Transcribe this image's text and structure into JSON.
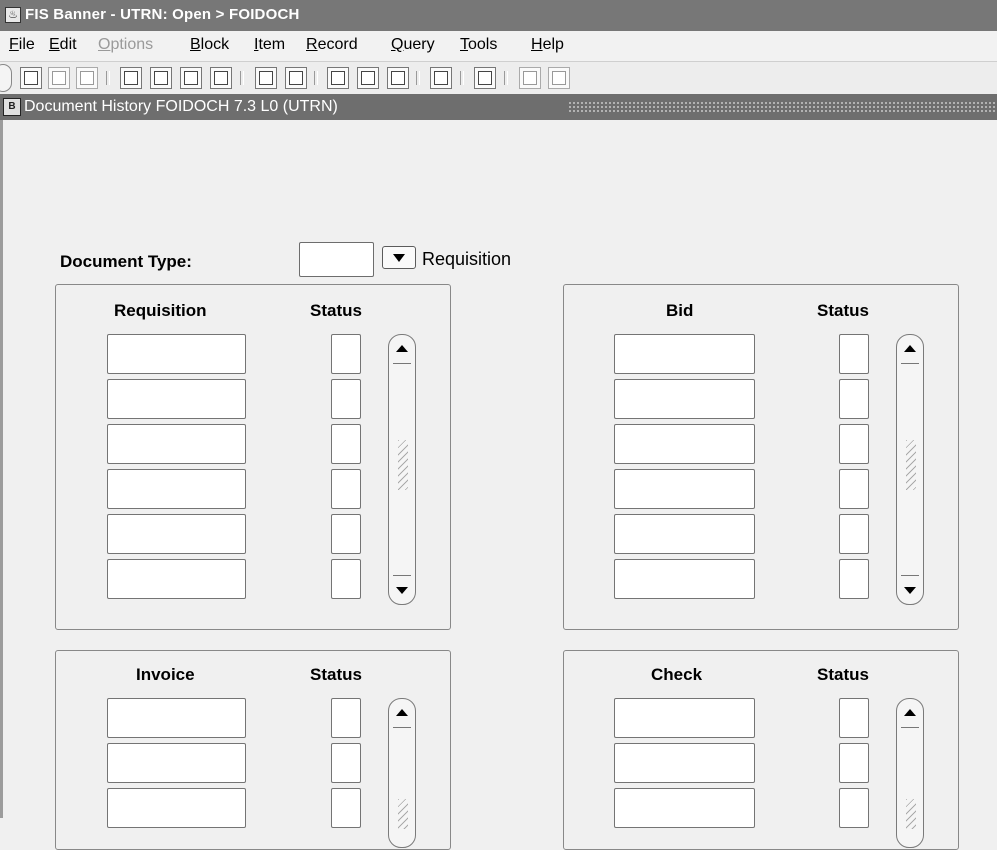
{
  "window": {
    "title": "FIS Banner - UTRN:  Open > FOIDOCH",
    "app_icon": "java-cup-icon"
  },
  "menu": {
    "items": [
      {
        "label": "File",
        "mnemonic": "F",
        "rest": "ile",
        "enabled": true
      },
      {
        "label": "Edit",
        "mnemonic": "E",
        "rest": "dit",
        "enabled": true
      },
      {
        "label": "Options",
        "mnemonic": "O",
        "rest": "ptions",
        "enabled": false
      },
      {
        "label": "Block",
        "mnemonic": "B",
        "rest": "lock",
        "enabled": true
      },
      {
        "label": "Item",
        "mnemonic": "I",
        "rest": "tem",
        "enabled": true
      },
      {
        "label": "Record",
        "mnemonic": "R",
        "rest": "ecord",
        "enabled": true
      },
      {
        "label": "Query",
        "mnemonic": "Q",
        "rest": "uery",
        "enabled": true
      },
      {
        "label": "Tools",
        "mnemonic": "T",
        "rest": "ools",
        "enabled": true
      },
      {
        "label": "Help",
        "mnemonic": "H",
        "rest": "elp",
        "enabled": true
      }
    ]
  },
  "toolbar": {
    "icons": [
      "save-icon",
      "rollback-icon",
      "document-icon",
      "previous-block-icon",
      "next-block-icon",
      "previous-record-icon",
      "next-record-icon",
      "enter-query-icon",
      "execute-query-icon",
      "help-icon",
      "list-of-values-icon",
      "cancel-icon",
      "print-preview-icon",
      "print-icon",
      "exit-icon",
      "extra-icon"
    ]
  },
  "form": {
    "title": "Document History  FOIDOCH  7.3 L0  (UTRN)",
    "icon": "banner-form-icon"
  },
  "document_type": {
    "label": "Document Type:",
    "value": "",
    "selected_text": "Requisition"
  },
  "panels": {
    "requisition": {
      "header": "Requisition",
      "status_header": "Status",
      "rows": [
        "",
        "",
        "",
        "",
        "",
        ""
      ],
      "statuses": [
        "",
        "",
        "",
        "",
        "",
        ""
      ]
    },
    "bid": {
      "header": "Bid",
      "status_header": "Status",
      "rows": [
        "",
        "",
        "",
        "",
        "",
        ""
      ],
      "statuses": [
        "",
        "",
        "",
        "",
        "",
        ""
      ]
    },
    "invoice": {
      "header": "Invoice",
      "status_header": "Status",
      "rows": [
        "",
        "",
        ""
      ],
      "statuses": [
        "",
        "",
        ""
      ]
    },
    "check": {
      "header": "Check",
      "status_header": "Status",
      "rows": [
        "",
        "",
        ""
      ],
      "statuses": [
        "",
        "",
        ""
      ]
    }
  },
  "colors": {
    "title_bar": "#777777",
    "form_bar": "#6e6e6e",
    "background": "#f0f0f0"
  }
}
